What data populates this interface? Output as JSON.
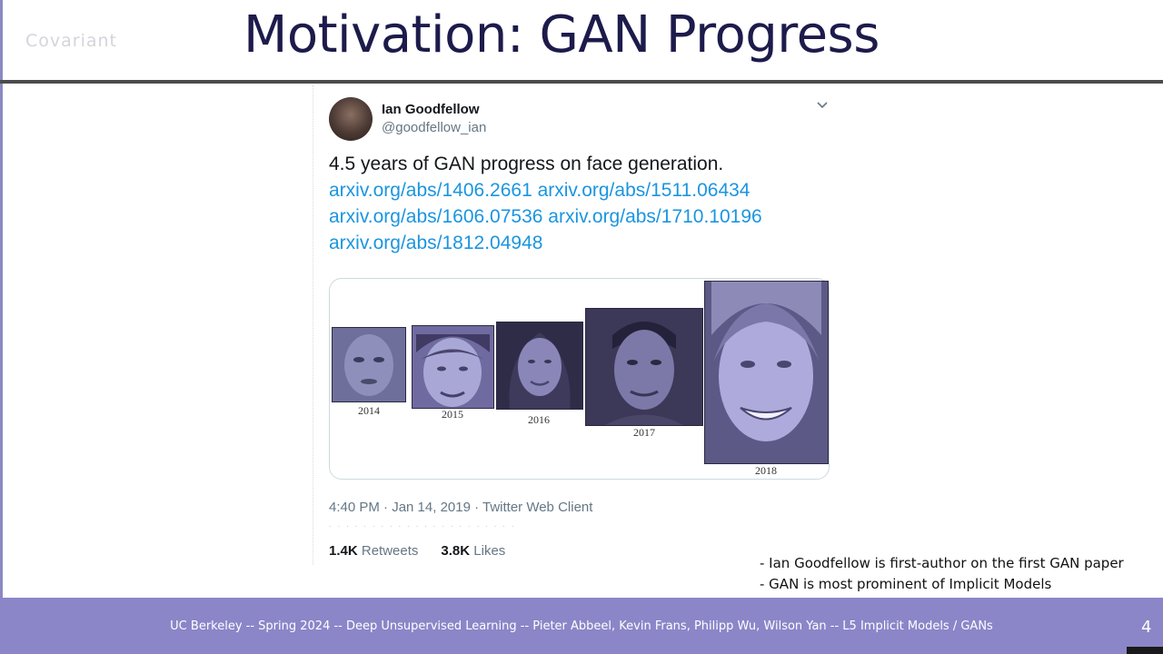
{
  "slide": {
    "title": "Motivation: GAN Progress",
    "logo_text": "Covariant"
  },
  "tweet": {
    "author_name": "Ian Goodfellow",
    "author_handle": "@goodfellow_ian",
    "text": "4.5 years of GAN progress on face generation.",
    "links": [
      "arxiv.org/abs/1406.2661 arxiv.org/abs/1511.06434",
      "arxiv.org/abs/1606.07536 arxiv.org/abs/1710.10196",
      "arxiv.org/abs/1812.04948"
    ],
    "images": [
      {
        "year": "2014",
        "color": "#6e6f9a"
      },
      {
        "year": "2015",
        "color": "#9897c8"
      },
      {
        "year": "2016",
        "color": "#6c6895"
      },
      {
        "year": "2017",
        "color": "#5f5b80"
      },
      {
        "year": "2018",
        "color": "#a19dd4"
      }
    ],
    "timestamp": "4:40 PM · Jan 14, 2019 · Twitter Web Client",
    "retweets_count": "1.4K",
    "retweets_label": "Retweets",
    "likes_count": "3.8K",
    "likes_label": "Likes"
  },
  "notes": [
    "- Ian Goodfellow is first-author on the first GAN paper",
    "- GAN is most prominent of Implicit Models"
  ],
  "footer": {
    "text": "UC Berkeley -- Spring 2024 -- Deep Unsupervised Learning -- Pieter Abbeel, Kevin Frans, Philipp Wu, Wilson Yan  -- L5 Implicit Models / GANs",
    "page_number": "4"
  },
  "colors": {
    "title": "#1d1b4b",
    "footer_bg": "#8b86c8",
    "link": "#1b95e0",
    "muted": "#657786"
  }
}
